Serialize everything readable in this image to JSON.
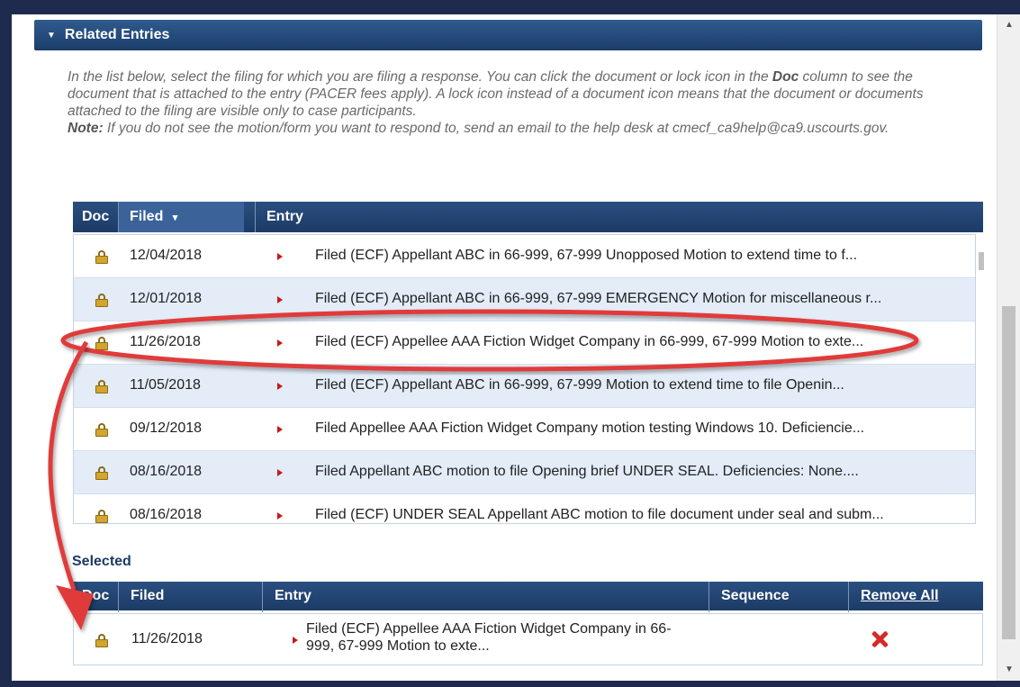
{
  "section": {
    "title": "Related Entries"
  },
  "instructions": {
    "line1_pre": "In the list below, select the filing for which you are filing a response. You can click the document or lock icon in the ",
    "line1_bold": "Doc",
    "line1_post": " column to see the document that is attached to the entry (PACER fees apply). A lock icon instead of a document icon means that the document or documents attached to the filing are visible only to case participants.",
    "note_label": "Note:",
    "note_text": " If you do not see the motion/form you want to respond to, send an email to the help desk at cmecf_ca9help@ca9.uscourts.gov."
  },
  "entries_table": {
    "columns": [
      "Doc",
      "Filed",
      "Entry"
    ],
    "sort_indicator": "▾",
    "rows": [
      {
        "filed": "12/04/2018",
        "entry": "Filed (ECF) Appellant ABC in 66-999, 67-999 Unopposed Motion to extend time to f..."
      },
      {
        "filed": "12/01/2018",
        "entry": "Filed (ECF) Appellant ABC in 66-999, 67-999 EMERGENCY Motion for miscellaneous r..."
      },
      {
        "filed": "11/26/2018",
        "entry": "Filed (ECF) Appellee AAA Fiction Widget Company in 66-999, 67-999 Motion to exte..."
      },
      {
        "filed": "11/05/2018",
        "entry": "Filed (ECF) Appellant ABC in 66-999, 67-999 Motion to extend time to file Openin..."
      },
      {
        "filed": "09/12/2018",
        "entry": "Filed Appellee AAA Fiction Widget Company motion testing Windows 10. Deficiencie..."
      },
      {
        "filed": "08/16/2018",
        "entry": "Filed Appellant ABC motion to file Opening brief UNDER SEAL. Deficiencies: None...."
      },
      {
        "filed": "08/16/2018",
        "entry": "Filed (ECF) UNDER SEAL Appellant ABC motion to file document under seal and subm..."
      }
    ]
  },
  "selected": {
    "label": "Selected",
    "columns": [
      "Doc",
      "Filed",
      "Entry",
      "Sequence",
      "Remove All"
    ],
    "row": {
      "filed": "11/26/2018",
      "entry_line1": "Filed (ECF) Appellee AAA Fiction Widget Company in 66-",
      "entry_line2": "999, 67-999 Motion to exte..."
    }
  },
  "colors": {
    "header_blue": "#1c3d6b",
    "row_alt": "#e3ecf7",
    "annotation_red": "#e03a3a",
    "frame": "#1f2a4f"
  }
}
